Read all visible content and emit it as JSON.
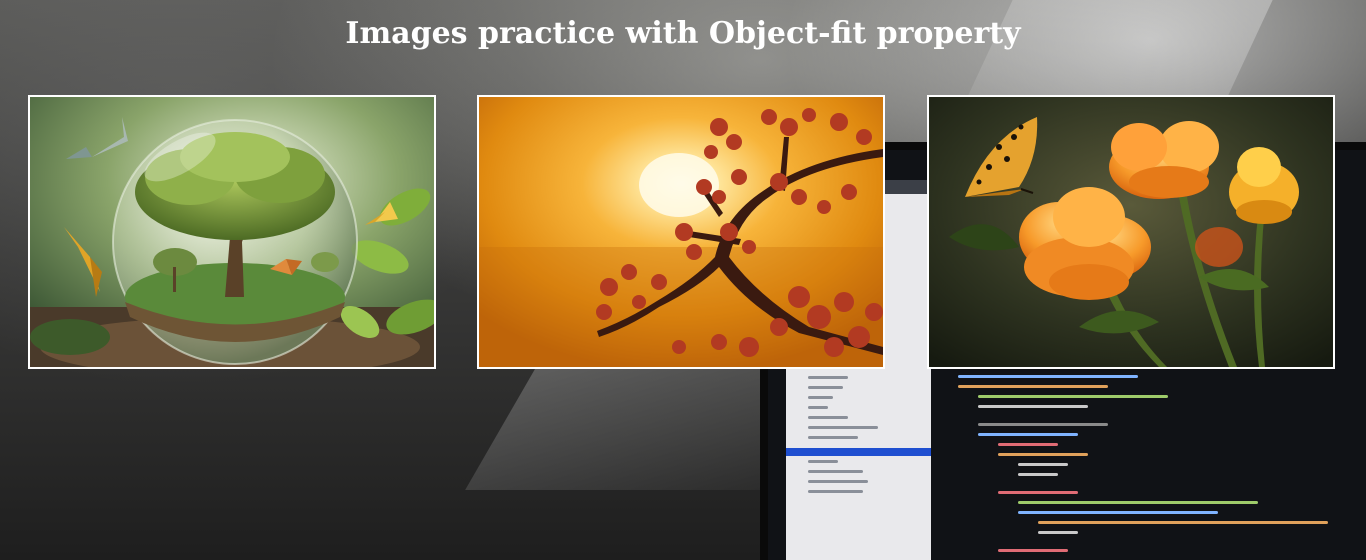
{
  "page": {
    "title": "Images practice with Object-fit property"
  },
  "gallery": {
    "images": [
      {
        "name": "tree-in-glass-sphere-image",
        "subject": "tree inside glass sphere with butterflies"
      },
      {
        "name": "sunset-blossom-image",
        "subject": "orange sunset with red blossom branch silhouette"
      },
      {
        "name": "orange-flowers-image",
        "subject": "orange flowers with butterfly"
      }
    ]
  },
  "colors": {
    "border": "#ffffff",
    "title_text": "#ffffff"
  }
}
